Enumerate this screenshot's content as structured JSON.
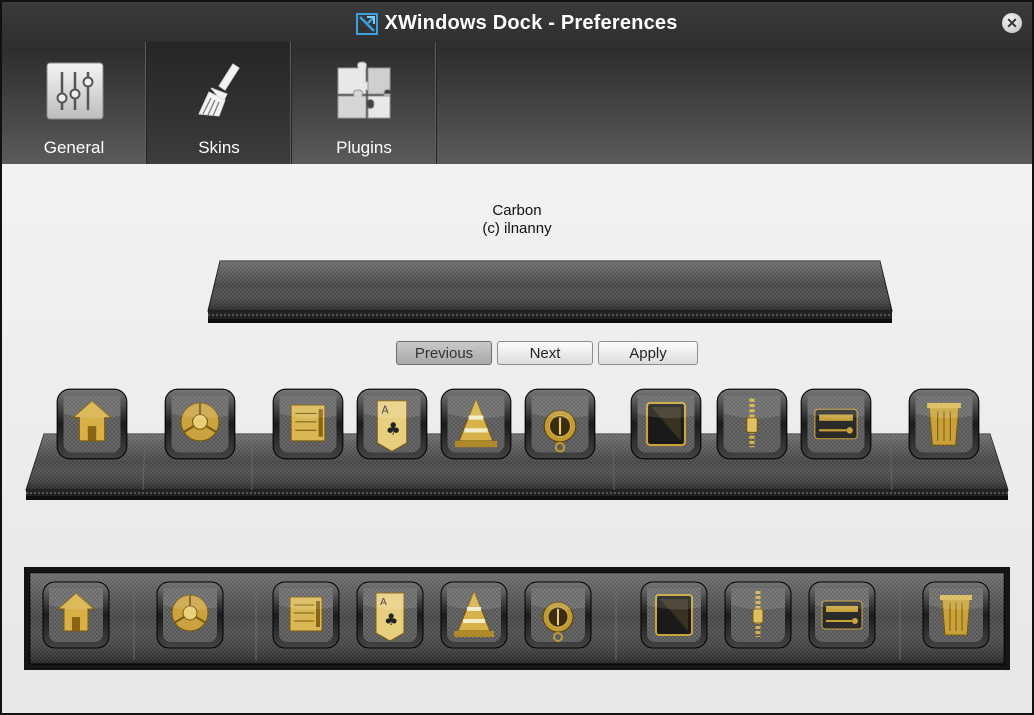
{
  "window": {
    "title": "XWindows Dock - Preferences",
    "close_glyph": "✕"
  },
  "tabs": [
    {
      "label": "General",
      "icon": "sliders-icon",
      "active": false
    },
    {
      "label": "Skins",
      "icon": "brush-icon",
      "active": true
    },
    {
      "label": "Plugins",
      "icon": "puzzle-icon",
      "active": false
    }
  ],
  "skin": {
    "name": "Carbon",
    "author": "(c) ilnanny"
  },
  "buttons": {
    "previous": "Previous",
    "next": "Next",
    "apply": "Apply"
  },
  "dock_icons": [
    {
      "name": "home-icon"
    },
    {
      "name": "chrome-icon"
    },
    {
      "name": "archive-icon"
    },
    {
      "name": "cards-icon"
    },
    {
      "name": "vlc-cone-icon"
    },
    {
      "name": "compass-icon"
    },
    {
      "name": "tablet-icon"
    },
    {
      "name": "zip-icon"
    },
    {
      "name": "radio-icon"
    },
    {
      "name": "trash-icon"
    }
  ],
  "colors": {
    "header_dark": "#2e2e2e",
    "gold": "#c9a23a",
    "carbon": "#3a3a3a"
  }
}
